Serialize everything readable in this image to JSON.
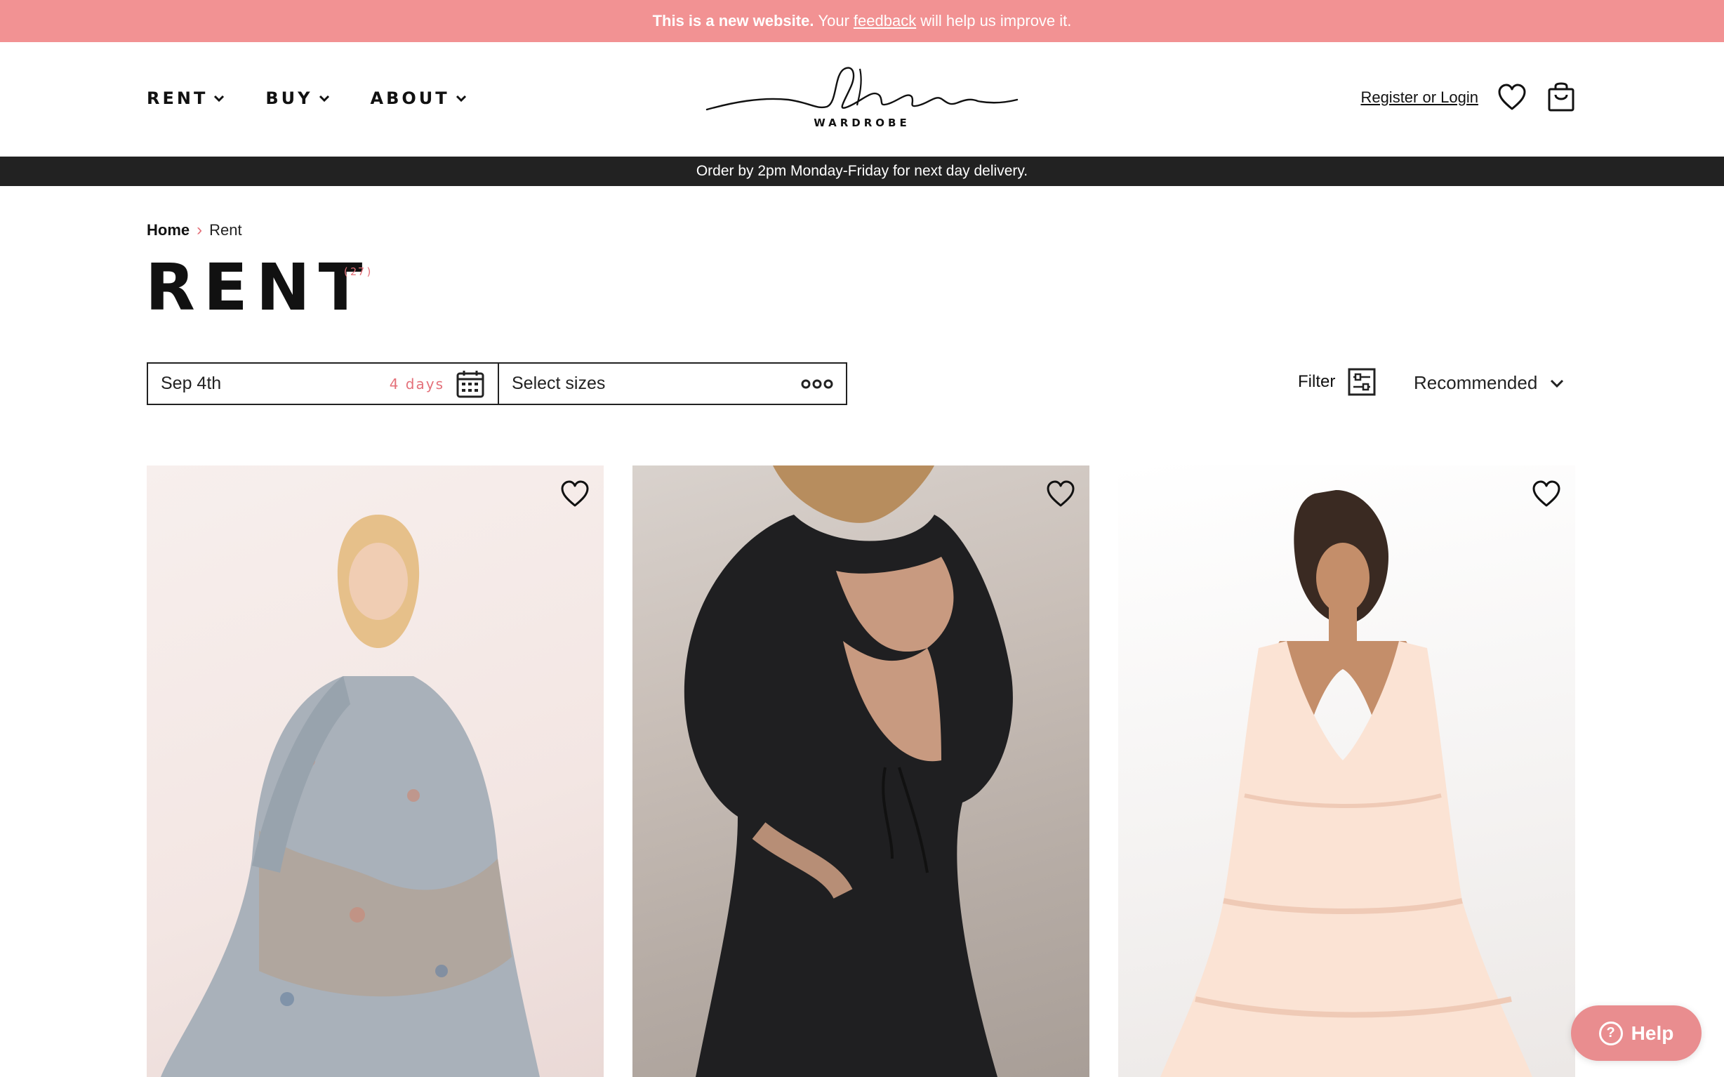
{
  "announcement": {
    "bold": "This is a new website.",
    "pre": "Your",
    "link": "feedback",
    "post": "will help us improve it."
  },
  "nav": {
    "items": [
      {
        "label": "RENT"
      },
      {
        "label": "BUY"
      },
      {
        "label": "ABOUT"
      }
    ]
  },
  "logo": {
    "script": "Endless",
    "sub": "WARDROBE"
  },
  "account": {
    "login_label": "Register or Login"
  },
  "delivery": {
    "text": "Order by 2pm Monday-Friday for next day delivery."
  },
  "breadcrumb": {
    "home": "Home",
    "separator": "›",
    "current": "Rent"
  },
  "page": {
    "title": "RENT",
    "count": "(27)"
  },
  "picker": {
    "date_value": "Sep 4th",
    "duration": "4 days",
    "sizes_placeholder": "Select sizes"
  },
  "toolbar": {
    "filter_label": "Filter",
    "sort_label": "Recommended"
  },
  "help": {
    "label": "Help"
  },
  "colors": {
    "announcement_bg": "#f29293",
    "accent": "#e4717a",
    "delivery_bar": "#222222",
    "help_button": "#e98d8f"
  },
  "icons": [
    "chevron-down-icon",
    "heart-icon",
    "bag-icon",
    "calendar-icon",
    "more-dots-icon",
    "filter-icon",
    "help-icon"
  ]
}
